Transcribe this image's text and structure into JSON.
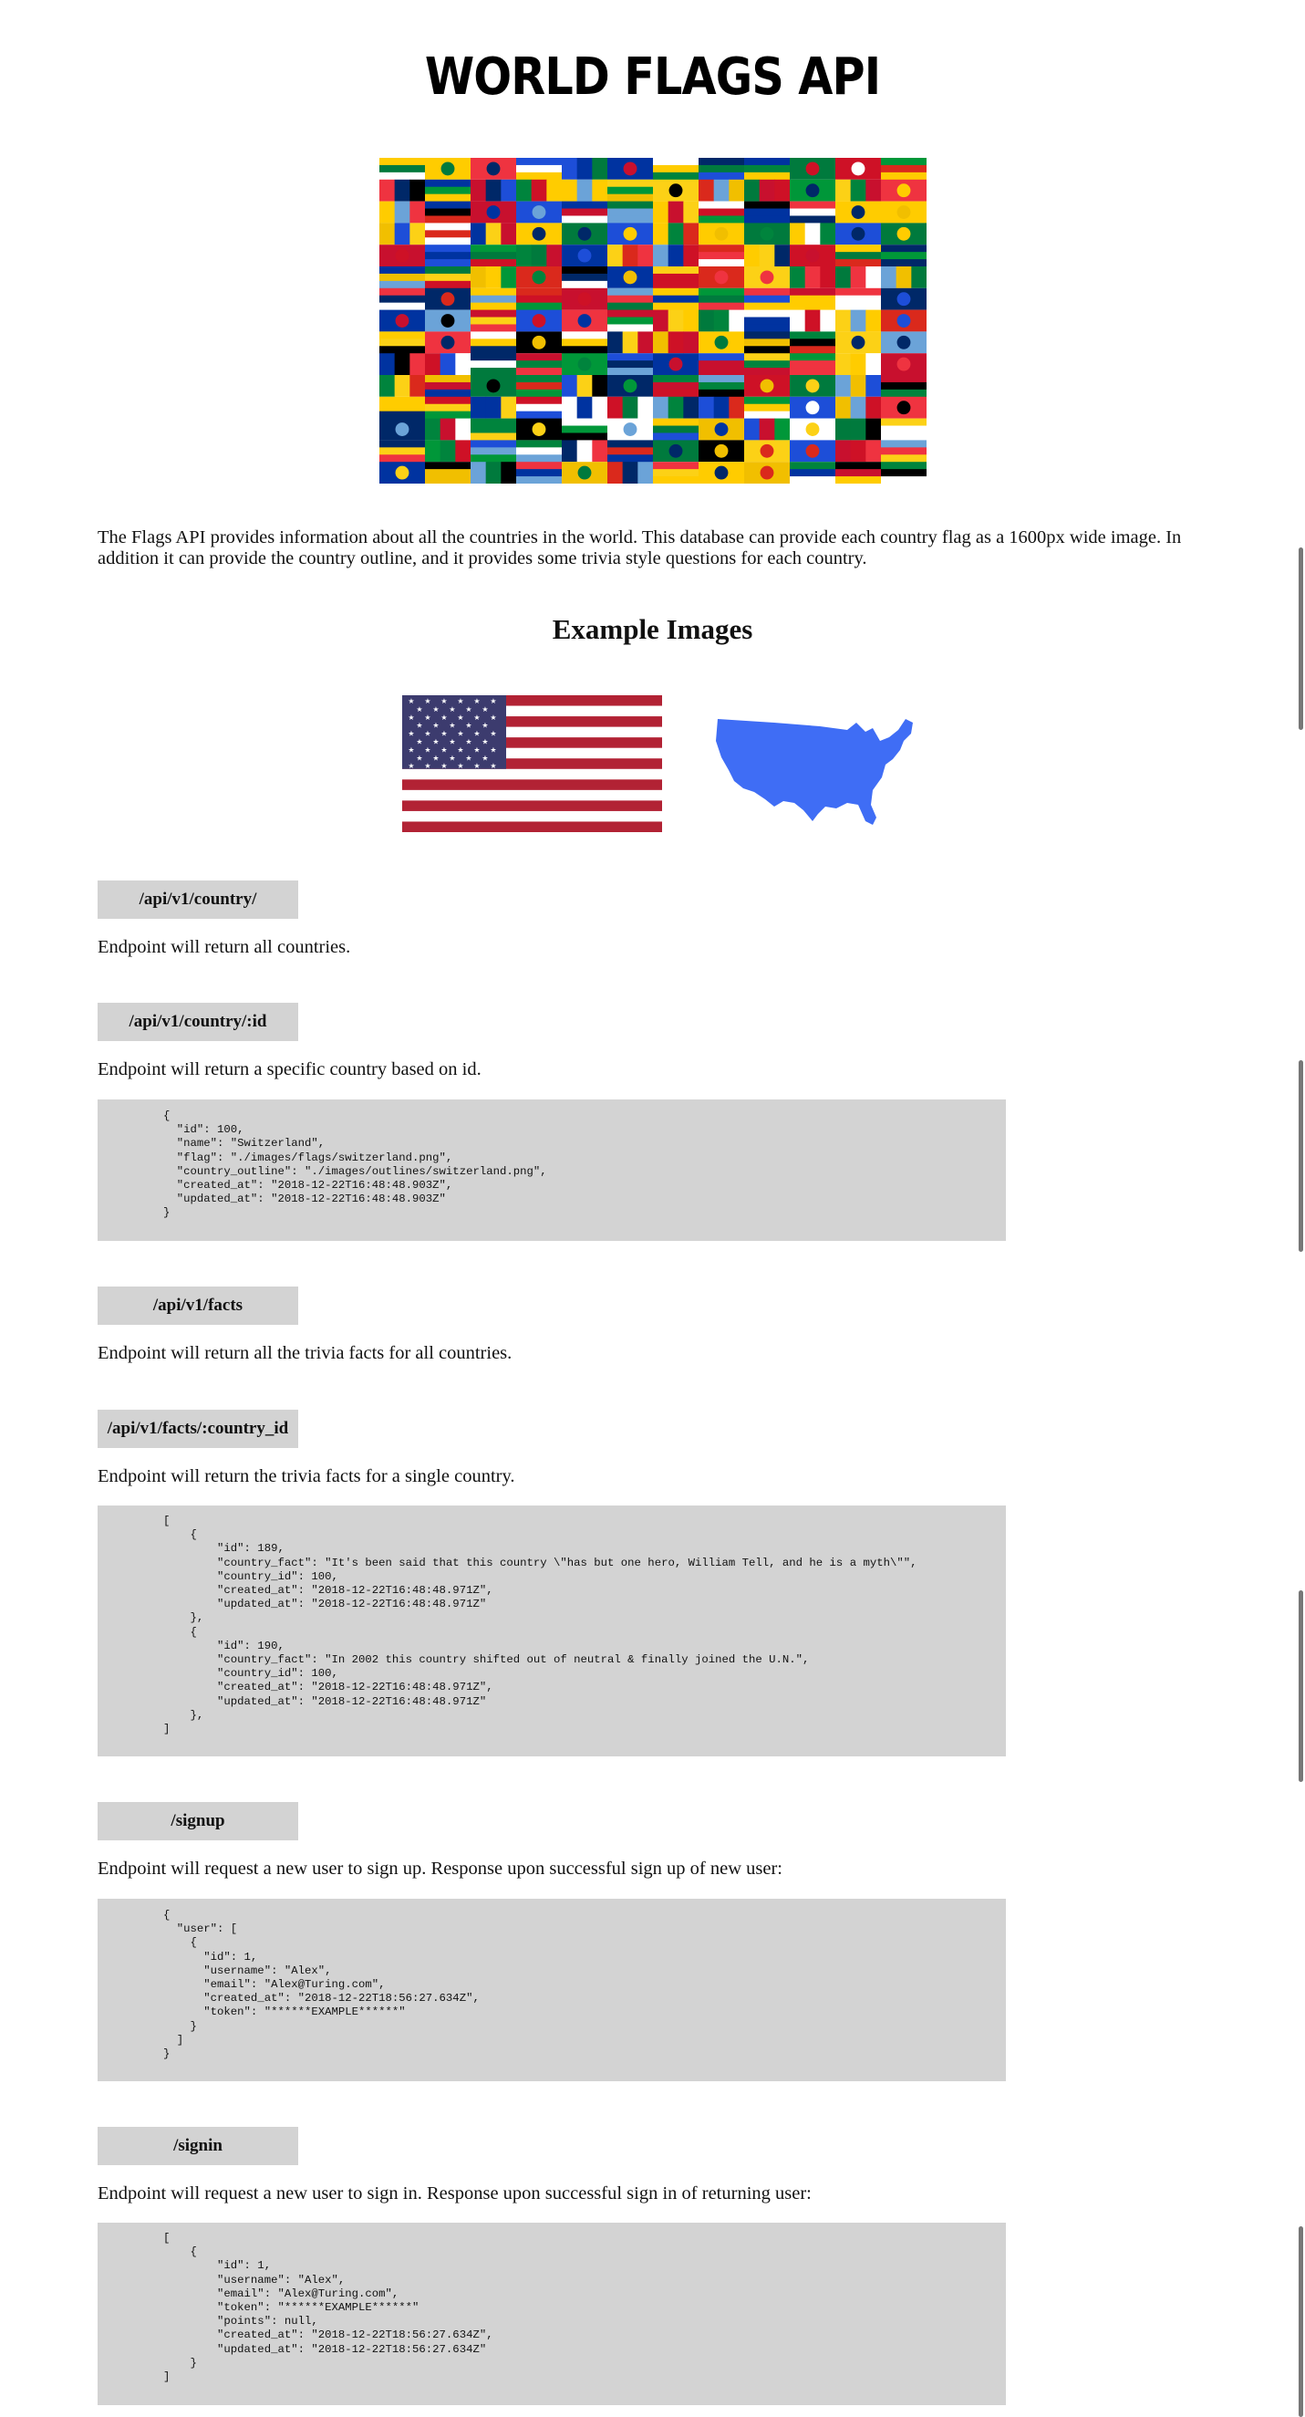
{
  "page": {
    "title": "WORLD FLAGS API"
  },
  "intro": "The Flags API provides information about all the countries in the world. This database can provide each country flag as a 1600px wide image. In addition it can provide the country outline, and it provides some trivia style questions for each country.",
  "examples": {
    "heading": "Example Images"
  },
  "endpoints": [
    {
      "path": "/api/v1/country/",
      "description": "Endpoint will return all countries."
    },
    {
      "path": "/api/v1/country/:id",
      "description": "Endpoint will return a specific country based on id.",
      "response": "{\n  \"id\": 100,\n  \"name\": \"Switzerland\",\n  \"flag\": \"./images/flags/switzerland.png\",\n  \"country_outline\": \"./images/outlines/switzerland.png\",\n  \"created_at\": \"2018-12-22T16:48:48.903Z\",\n  \"updated_at\": \"2018-12-22T16:48:48.903Z\"\n}"
    },
    {
      "path": "/api/v1/facts",
      "description": "Endpoint will return all the trivia facts for all countries."
    },
    {
      "path": "/api/v1/facts/:country_id",
      "description": "Endpoint will return the trivia facts for a single country.",
      "response": "[\n    {\n        \"id\": 189,\n        \"country_fact\": \"It's been said that this country \\\"has but one hero, William Tell, and he is a myth\\\"\",\n        \"country_id\": 100,\n        \"created_at\": \"2018-12-22T16:48:48.971Z\",\n        \"updated_at\": \"2018-12-22T16:48:48.971Z\"\n    },\n    {\n        \"id\": 190,\n        \"country_fact\": \"In 2002 this country shifted out of neutral & finally joined the U.N.\",\n        \"country_id\": 100,\n        \"created_at\": \"2018-12-22T16:48:48.971Z\",\n        \"updated_at\": \"2018-12-22T16:48:48.971Z\"\n    },\n]"
    },
    {
      "path": "/signup",
      "description": "Endpoint will request a new user to sign up. Response upon successful sign up of new user:",
      "response": "{\n  \"user\": [\n    {\n      \"id\": 1,\n      \"username\": \"Alex\",\n      \"email\": \"Alex@Turing.com\",\n      \"created_at\": \"2018-12-22T18:56:27.634Z\",\n      \"token\": \"******EXAMPLE******\"\n    }\n  ]\n}"
    },
    {
      "path": "/signin",
      "description": "Endpoint will request a new user to sign in. Response upon successful sign in of returning user:",
      "response": "[\n    {\n        \"id\": 1,\n        \"username\": \"Alex\",\n        \"email\": \"Alex@Turing.com\",\n        \"token\": \"******EXAMPLE******\"\n        \"points\": null,\n        \"created_at\": \"2018-12-22T18:56:27.634Z\",\n        \"updated_at\": \"2018-12-22T18:56:27.634Z\"\n    }\n]"
    }
  ],
  "icons": {
    "flag_mosaic": "world-flags-mosaic",
    "example_flag": "us-flag-icon",
    "example_outline": "us-outline-icon"
  },
  "colors": {
    "code_bg": "#d3d3d3",
    "us_red": "#b22234",
    "us_blue": "#3c3b6e",
    "outline_blue": "#3f6df5"
  }
}
